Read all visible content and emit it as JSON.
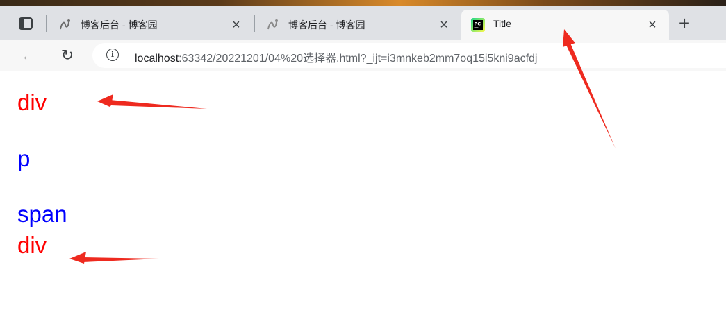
{
  "browser": {
    "tabs": [
      {
        "title": "博客后台 - 博客园",
        "active": false,
        "icon": "cnblogs-icon"
      },
      {
        "title": "博客后台 - 博客园",
        "active": false,
        "icon": "cnblogs-icon"
      },
      {
        "title": "Title",
        "active": true,
        "icon": "pycharm-icon"
      }
    ],
    "close_glyph": "×",
    "new_tab_glyph": "+",
    "back_glyph": "←",
    "reload_glyph": "↻",
    "info_glyph": "i",
    "url_host": "localhost",
    "url_rest": ":63342/20221201/04%20选择器.html?_ijt=i3mnkeb2mm7oq15i5kni9acfdj"
  },
  "page": {
    "lines": [
      "div",
      "p",
      "span",
      "div"
    ],
    "colors": {
      "div": "#ff0000",
      "p": "#0000ff",
      "span": "#0000ff"
    }
  },
  "annotations": {
    "arrow_color": "#ee2a1f",
    "arrows": 3
  }
}
